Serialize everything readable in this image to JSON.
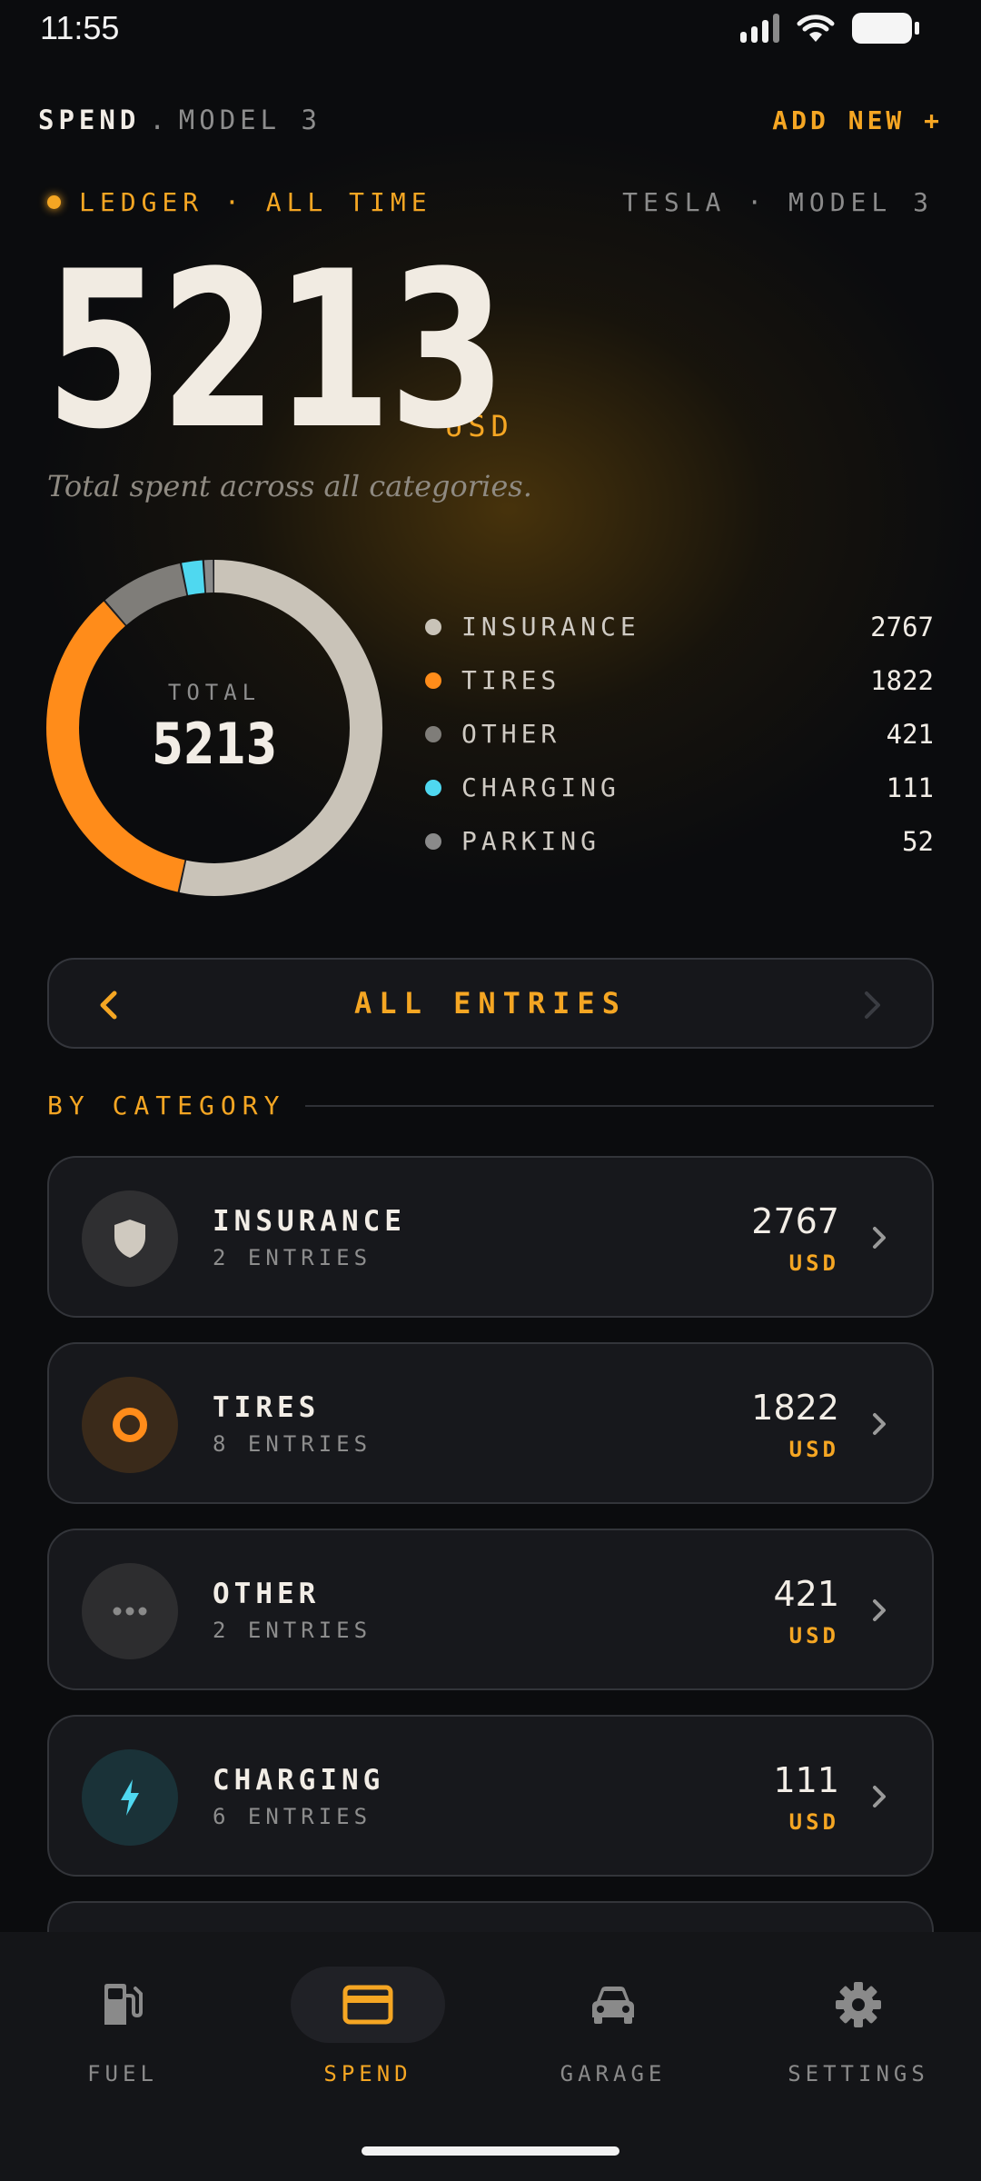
{
  "status_bar": {
    "time": "11:55"
  },
  "header": {
    "title": "SPEND",
    "separator": ".",
    "subtitle": "MODEL 3",
    "add_new": "ADD NEW +"
  },
  "ledger": {
    "label": "LEDGER · ALL TIME",
    "vehicle": "TESLA · MODEL 3"
  },
  "total": {
    "value": "5213",
    "unit": "USD",
    "caption": "Total spent across all categories."
  },
  "donut": {
    "center_label": "TOTAL",
    "center_value": "5213"
  },
  "chart_data": {
    "type": "pie",
    "categories": [
      "INSURANCE",
      "TIRES",
      "OTHER",
      "CHARGING",
      "PARKING"
    ],
    "values": [
      2767,
      1822,
      421,
      111,
      52
    ],
    "colors": [
      "#c9c3b8",
      "#ff8c1a",
      "#7f7d79",
      "#4fd8f0",
      "#8a8a8a"
    ],
    "style": "donut"
  },
  "legend": [
    {
      "name": "INSURANCE",
      "value": "2767",
      "color": "#c9c3b8"
    },
    {
      "name": "TIRES",
      "value": "1822",
      "color": "#ff8c1a"
    },
    {
      "name": "OTHER",
      "value": "421",
      "color": "#7f7d79"
    },
    {
      "name": "CHARGING",
      "value": "111",
      "color": "#4fd8f0"
    },
    {
      "name": "PARKING",
      "value": "52",
      "color": "#8a8a8a"
    }
  ],
  "entries_bar": {
    "label": "ALL ENTRIES"
  },
  "section": {
    "title": "BY CATEGORY"
  },
  "categories": [
    {
      "name": "INSURANCE",
      "entries": "2 ENTRIES",
      "value": "2767",
      "unit": "USD",
      "icon": "shield-icon"
    },
    {
      "name": "TIRES",
      "entries": "8 ENTRIES",
      "value": "1822",
      "unit": "USD",
      "icon": "tire-icon"
    },
    {
      "name": "OTHER",
      "entries": "2 ENTRIES",
      "value": "421",
      "unit": "USD",
      "icon": "more-dots-icon"
    },
    {
      "name": "CHARGING",
      "entries": "6 ENTRIES",
      "value": "111",
      "unit": "USD",
      "icon": "lightning-icon"
    }
  ],
  "nav": [
    {
      "label": "FUEL",
      "icon": "fuel-pump-icon",
      "active": false
    },
    {
      "label": "SPEND",
      "icon": "credit-card-icon",
      "active": true
    },
    {
      "label": "GARAGE",
      "icon": "car-icon",
      "active": false
    },
    {
      "label": "SETTINGS",
      "icon": "gear-icon",
      "active": false
    }
  ],
  "colors": {
    "accent": "#f5a623",
    "background": "#0b0c0e",
    "card": "#17181c"
  }
}
